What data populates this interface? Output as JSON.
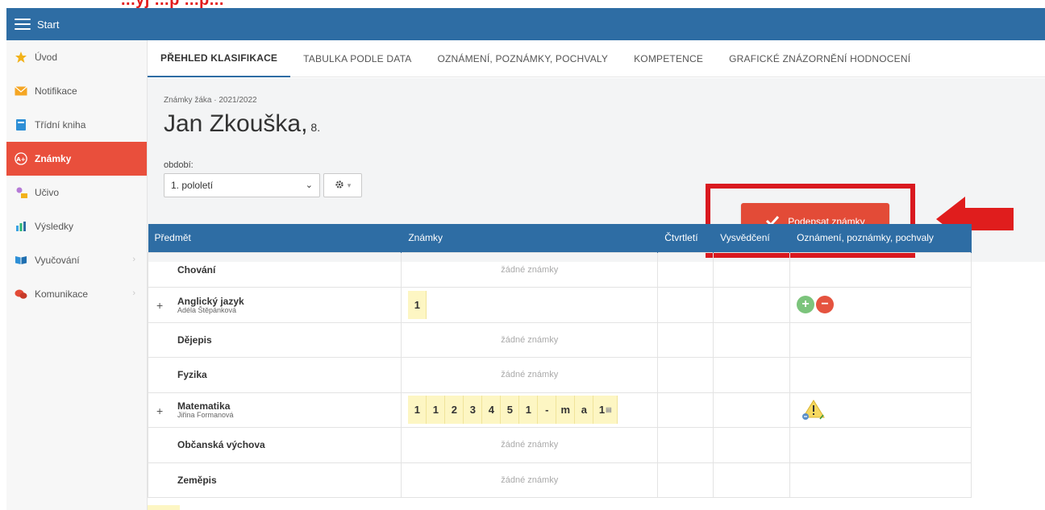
{
  "caption": "...yj ...p ...p...",
  "topbar": {
    "title": "Start"
  },
  "sidebar": {
    "items": [
      {
        "label": "Úvod",
        "icon": "star-icon"
      },
      {
        "label": "Notifikace",
        "icon": "envelope-icon"
      },
      {
        "label": "Třídní kniha",
        "icon": "book-icon"
      },
      {
        "label": "Známky",
        "icon": "grades-icon",
        "active": true
      },
      {
        "label": "Učivo",
        "icon": "study-icon"
      },
      {
        "label": "Výsledky",
        "icon": "bar-chart-icon"
      },
      {
        "label": "Vyučování",
        "icon": "open-book-icon"
      },
      {
        "label": "Komunikace",
        "icon": "chat-icon"
      }
    ]
  },
  "tabs": [
    {
      "label": "PŘEHLED KLASIFIKACE",
      "active": true
    },
    {
      "label": "TABULKA PODLE DATA"
    },
    {
      "label": "OZNÁMENÍ, POZNÁMKY, POCHVALY"
    },
    {
      "label": "KOMPETENCE"
    },
    {
      "label": "GRAFICKÉ ZNÁZORNĚNÍ HODNOCENÍ"
    }
  ],
  "header": {
    "subtitle": "Známky žáka · 2021/2022",
    "student_name": "Jan Zkouška,",
    "student_class": "8.",
    "period_label": "období:",
    "period_value": "1. pololetí",
    "sign_button": "Podepsat známky"
  },
  "table": {
    "columns": [
      "Předmět",
      "Známky",
      "Čtvrtletí",
      "Vysvědčení",
      "Oznámení, poznámky, pochvaly"
    ],
    "empty_text": "žádné známky",
    "rows": [
      {
        "subject": "Chování",
        "teacher": "",
        "marks": []
      },
      {
        "subject": "Anglický jazyk",
        "teacher": "Adéla Štěpánková",
        "marks": [
          "1"
        ],
        "expandable": true,
        "notes": [
          "plus",
          "minus"
        ]
      },
      {
        "subject": "Dějepis",
        "teacher": "",
        "marks": []
      },
      {
        "subject": "Fyzika",
        "teacher": "",
        "marks": []
      },
      {
        "subject": "Matematika",
        "teacher": "Jiřina Formanová",
        "marks": [
          "1",
          "1",
          "2",
          "3",
          "4",
          "5",
          "1",
          "-",
          "m",
          "a",
          "1"
        ],
        "expandable": true,
        "notes": [
          "warning"
        ]
      },
      {
        "subject": "Občanská výchova",
        "teacher": "",
        "marks": []
      },
      {
        "subject": "Zeměpis",
        "teacher": "",
        "marks": []
      }
    ]
  }
}
